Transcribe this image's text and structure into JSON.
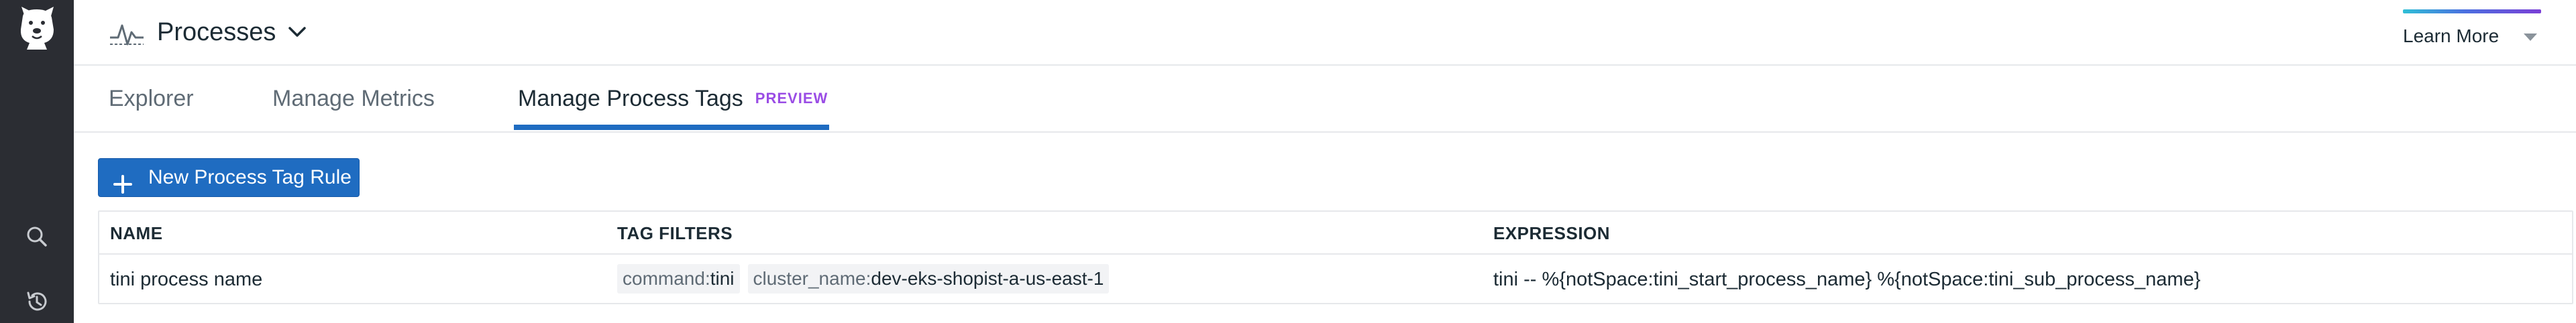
{
  "header": {
    "title": "Processes",
    "learn_more_label": "Learn More"
  },
  "tabs": [
    {
      "label": "Explorer"
    },
    {
      "label": "Manage Metrics"
    },
    {
      "label": "Manage Process Tags",
      "badge": "PREVIEW",
      "active": true
    }
  ],
  "toolbar": {
    "new_rule_label": "New Process Tag Rule"
  },
  "table": {
    "columns": [
      "NAME",
      "TAG FILTERS",
      "EXPRESSION"
    ],
    "rows": [
      {
        "name": "tini process name",
        "tag_filters": [
          {
            "key": "command:",
            "value": "tini"
          },
          {
            "key": "cluster_name:",
            "value": "dev-eks-shopist-a-us-east-1"
          }
        ],
        "expression": "tini -- %{notSpace:tini_start_process_name} %{notSpace:tini_sub_process_name}"
      }
    ]
  },
  "icons": {
    "logo": "datadog-dog-logo",
    "search": "search-icon",
    "history": "history-icon",
    "processes": "processes-pulse-icon",
    "chevron": "chevron-down-icon",
    "caret": "caret-down-icon",
    "plus": "plus-icon"
  },
  "colors": {
    "nav_background": "#2b2d33",
    "primary_button": "#1f6cc1",
    "active_tab_underline": "#1f6cc1",
    "preview_badge": "#9a4ce5",
    "tag_chip_background": "#f2f3f5"
  }
}
